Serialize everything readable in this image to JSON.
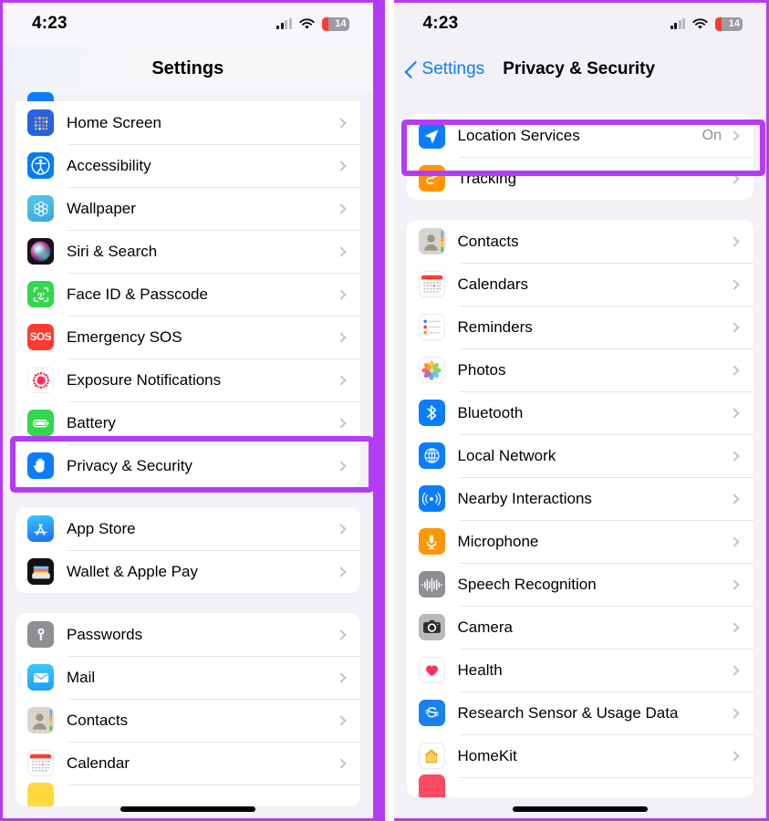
{
  "theme": {
    "highlight_color": "#b43cf5",
    "accent_blue": "#0a7cff",
    "secondary_text": "#8e8e93"
  },
  "left_phone": {
    "status_bar": {
      "time": "4:23",
      "battery_level": "14",
      "signal_icon": "cellular-signal-icon",
      "wifi_icon": "wifi-icon",
      "battery_icon": "battery-low-icon"
    },
    "nav": {
      "title": "Settings"
    },
    "groups": [
      {
        "name": "system-group",
        "rows": [
          {
            "label": "Home Screen",
            "icon": "home-screen-icon",
            "value": ""
          },
          {
            "label": "Accessibility",
            "icon": "accessibility-icon",
            "value": ""
          },
          {
            "label": "Wallpaper",
            "icon": "wallpaper-icon",
            "value": ""
          },
          {
            "label": "Siri & Search",
            "icon": "siri-icon",
            "value": ""
          },
          {
            "label": "Face ID & Passcode",
            "icon": "face-id-icon",
            "value": ""
          },
          {
            "label": "Emergency SOS",
            "icon": "emergency-sos-icon",
            "value": ""
          },
          {
            "label": "Exposure Notifications",
            "icon": "exposure-notifications-icon",
            "value": ""
          },
          {
            "label": "Battery",
            "icon": "battery-settings-icon",
            "value": ""
          },
          {
            "label": "Privacy & Security",
            "icon": "privacy-hand-icon",
            "value": ""
          }
        ]
      },
      {
        "name": "store-group",
        "rows": [
          {
            "label": "App Store",
            "icon": "app-store-icon",
            "value": ""
          },
          {
            "label": "Wallet & Apple Pay",
            "icon": "wallet-icon",
            "value": ""
          }
        ]
      },
      {
        "name": "accounts-group",
        "rows": [
          {
            "label": "Passwords",
            "icon": "passwords-key-icon",
            "value": ""
          },
          {
            "label": "Mail",
            "icon": "mail-icon",
            "value": ""
          },
          {
            "label": "Contacts",
            "icon": "contacts-icon",
            "value": ""
          },
          {
            "label": "Calendar",
            "icon": "calendar-icon",
            "value": ""
          }
        ]
      }
    ],
    "highlighted_row": "Privacy & Security"
  },
  "right_phone": {
    "status_bar": {
      "time": "4:23",
      "battery_level": "14",
      "signal_icon": "cellular-signal-icon",
      "wifi_icon": "wifi-icon",
      "battery_icon": "battery-low-icon"
    },
    "nav": {
      "back_label": "Settings",
      "back_icon": "chevron-left-icon",
      "title": "Privacy & Security"
    },
    "groups": [
      {
        "name": "location-group",
        "rows": [
          {
            "label": "Location Services",
            "icon": "location-services-icon",
            "value": "On"
          },
          {
            "label": "Tracking",
            "icon": "tracking-icon",
            "value": ""
          }
        ]
      },
      {
        "name": "permissions-group",
        "rows": [
          {
            "label": "Contacts",
            "icon": "contacts-icon",
            "value": ""
          },
          {
            "label": "Calendars",
            "icon": "calendar-icon",
            "value": ""
          },
          {
            "label": "Reminders",
            "icon": "reminders-icon",
            "value": ""
          },
          {
            "label": "Photos",
            "icon": "photos-icon",
            "value": ""
          },
          {
            "label": "Bluetooth",
            "icon": "bluetooth-icon",
            "value": ""
          },
          {
            "label": "Local Network",
            "icon": "local-network-icon",
            "value": ""
          },
          {
            "label": "Nearby Interactions",
            "icon": "nearby-interactions-icon",
            "value": ""
          },
          {
            "label": "Microphone",
            "icon": "microphone-icon",
            "value": ""
          },
          {
            "label": "Speech Recognition",
            "icon": "speech-recognition-icon",
            "value": ""
          },
          {
            "label": "Camera",
            "icon": "camera-icon",
            "value": ""
          },
          {
            "label": "Health",
            "icon": "health-heart-icon",
            "value": ""
          },
          {
            "label": "Research Sensor & Usage Data",
            "icon": "research-sensor-icon",
            "value": ""
          },
          {
            "label": "HomeKit",
            "icon": "homekit-icon",
            "value": ""
          }
        ]
      }
    ],
    "highlighted_row": "Location Services"
  }
}
